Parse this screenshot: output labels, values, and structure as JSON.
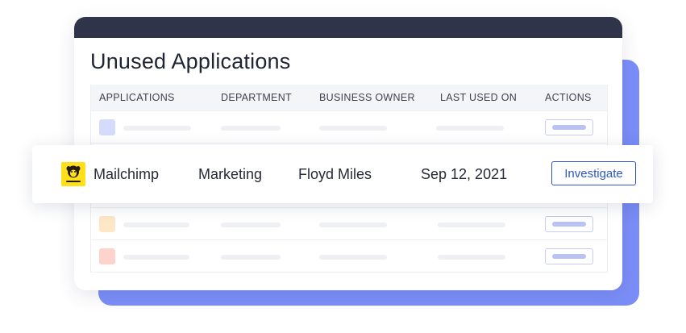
{
  "card": {
    "title": "Unused Applications"
  },
  "table": {
    "columns": [
      "APPLICATIONS",
      "DEPARTMENT",
      "BUSINESS OWNER",
      "LAST USED ON",
      "ACTIONS"
    ],
    "placeholder_row_colors": [
      "#d5dcfb",
      "#fde7c7",
      "#fdd3cc"
    ]
  },
  "featured_row": {
    "application": "Mailchimp",
    "logo_icon": "mailchimp-logo-icon",
    "logo_color": "#ffe01b",
    "department": "Marketing",
    "business_owner": "Floyd Miles",
    "last_used_on": "Sep 12, 2021",
    "action_label": "Investigate"
  },
  "colors": {
    "header": "#30344a",
    "accent": "#7b8ef8",
    "button": "#2e55c9"
  }
}
